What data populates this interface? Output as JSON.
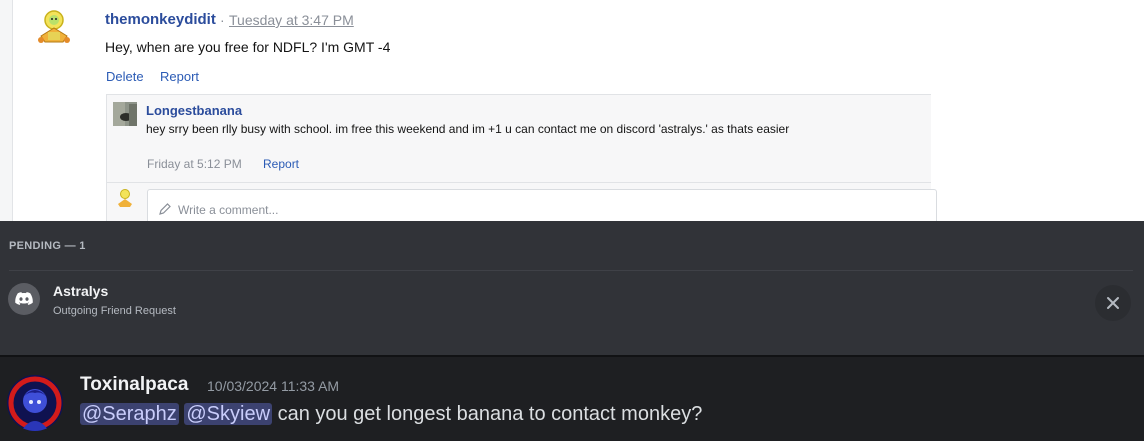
{
  "forum": {
    "post": {
      "author": "themonkeydidit",
      "separator": "·",
      "time": "Tuesday at 3:47 PM",
      "body": "Hey, when are you free for NDFL? I'm GMT -4",
      "actions": {
        "delete": "Delete",
        "report": "Report"
      }
    },
    "reply": {
      "author": "Longestbanana",
      "body": "hey srry been rlly busy with school. im free this weekend and im +1 u can contact me on discord 'astralys.' as thats easier",
      "time": "Friday at 5:12 PM",
      "report": "Report"
    },
    "comment": {
      "placeholder": "Write a comment..."
    }
  },
  "discord_friends": {
    "section_label": "PENDING — 1",
    "request": {
      "name": "Astralys",
      "subtitle": "Outgoing Friend Request",
      "icon": "discord-logo-icon",
      "cancel_icon": "close-icon"
    }
  },
  "discord_chat": {
    "username": "Toxinalpaca",
    "timestamp": "10/03/2024 11:33 AM",
    "mention1": "@Seraphz",
    "mention2": "@Skyiew",
    "message": "can you get longest banana to contact monkey?",
    "colors": {
      "mention_bg": "#3c4270",
      "mention_text": "#c9cdfb"
    }
  }
}
